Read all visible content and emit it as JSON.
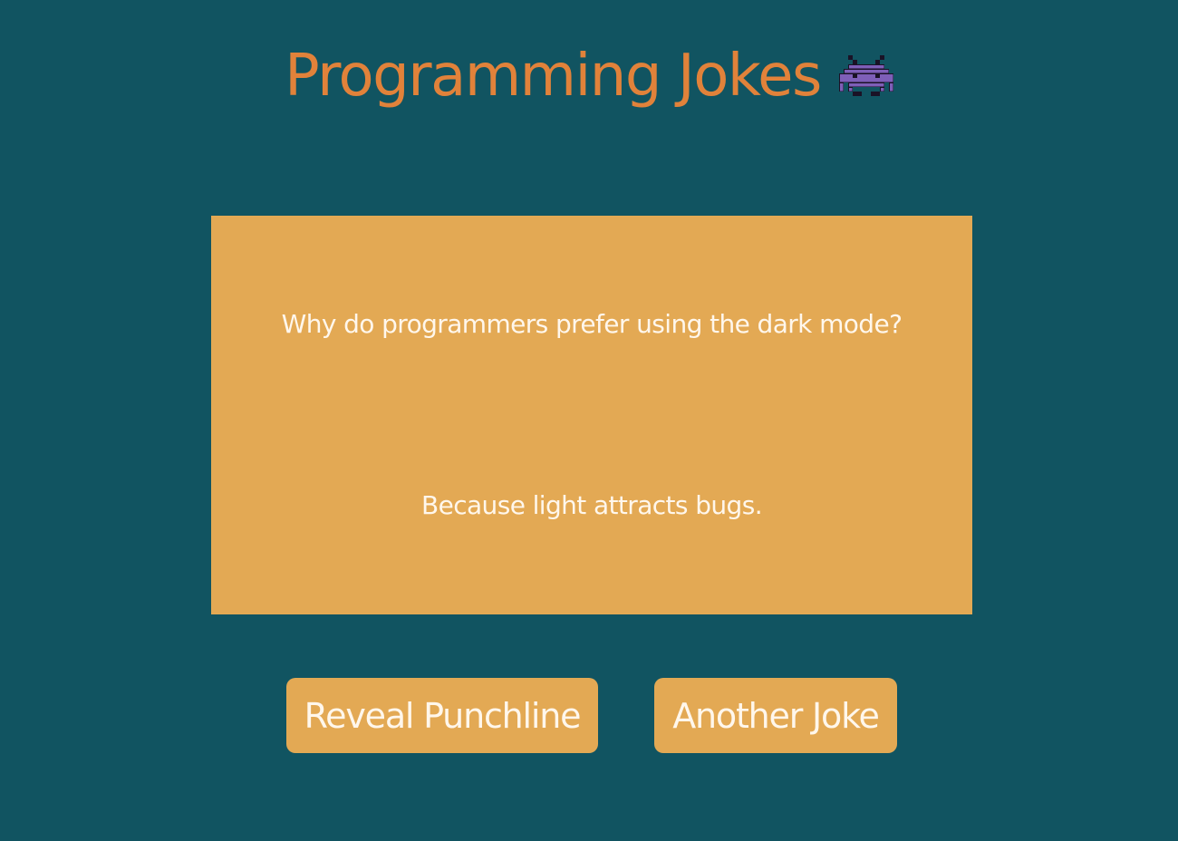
{
  "header": {
    "title": "Programming Jokes",
    "icon": "alien-monster-icon"
  },
  "joke": {
    "setup": "Why do programmers prefer using the dark mode?",
    "punchline": "Because light attracts bugs."
  },
  "buttons": {
    "reveal_label": "Reveal Punchline",
    "another_label": "Another Joke"
  },
  "colors": {
    "background": "#115461",
    "title": "#E1823A",
    "card": "#E3A954",
    "text": "#FFF7EC",
    "icon": "#7E5FB8"
  }
}
